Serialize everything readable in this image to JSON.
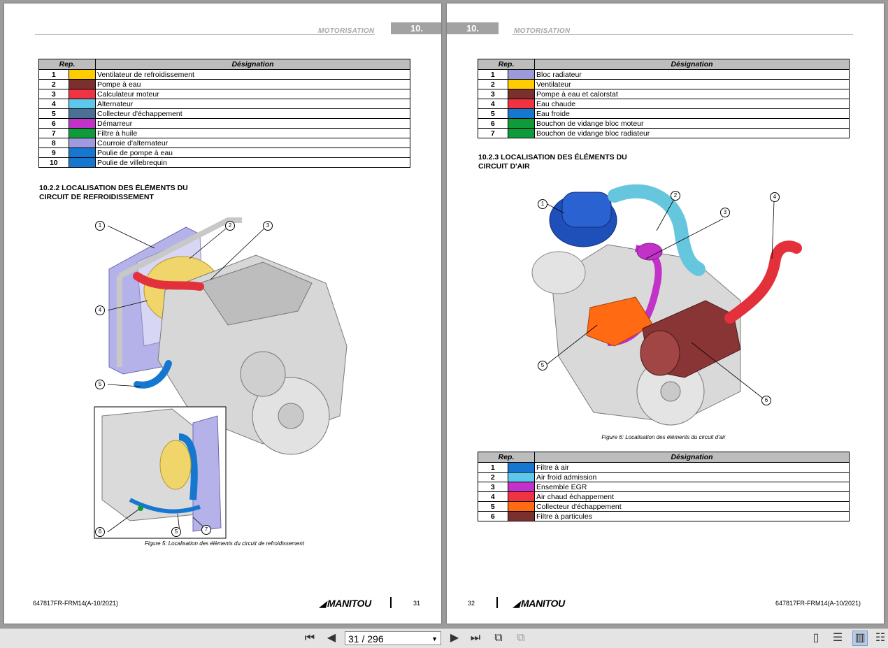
{
  "left_page": {
    "header": {
      "title": "MOTORISATION",
      "section": "10."
    },
    "table1": {
      "headers": {
        "rep": "Rep.",
        "designation": "Désignation"
      },
      "rows": [
        {
          "num": "1",
          "color": "#ffcc00",
          "label": "Ventilateur de refroidissement"
        },
        {
          "num": "2",
          "color": "#7b3030",
          "label": "Pompe à eau"
        },
        {
          "num": "3",
          "color": "#ef3340",
          "label": "Calculateur moteur"
        },
        {
          "num": "4",
          "color": "#5ec8ec",
          "label": "Alternateur"
        },
        {
          "num": "5",
          "color": "#4a7195",
          "label": "Collecteur d'échappement"
        },
        {
          "num": "6",
          "color": "#c232c8",
          "label": "Démarreur"
        },
        {
          "num": "7",
          "color": "#0f9b3a",
          "label": "Filtre à huile"
        },
        {
          "num": "8",
          "color": "#a09ade",
          "label": "Courroie d'alternateur"
        },
        {
          "num": "9",
          "color": "#1677d1",
          "label": "Poulie de pompe à eau"
        },
        {
          "num": "10",
          "color": "#1677d1",
          "label": "Poulie de villebrequin"
        }
      ]
    },
    "section_title_line1": "10.2.2 LOCALISATION DES ÉLÉMENTS DU",
    "section_title_line2": "CIRCUIT DE REFROIDISSEMENT",
    "figure_caption": "Figure 5: Localisation des éléments du circuit de refroidissement",
    "callouts": [
      "1",
      "2",
      "3",
      "4",
      "5",
      "6",
      "5",
      "7"
    ],
    "footer": {
      "code": "647817FR-FRM14(A-10/2021)",
      "brand": "MANITOU",
      "page": "31"
    }
  },
  "right_page": {
    "header": {
      "title": "MOTORISATION",
      "section": "10."
    },
    "table1": {
      "headers": {
        "rep": "Rep.",
        "designation": "Désignation"
      },
      "rows": [
        {
          "num": "1",
          "color": "#9b9bdc",
          "label": "Bloc radiateur"
        },
        {
          "num": "2",
          "color": "#ffcc00",
          "label": "Ventilateur"
        },
        {
          "num": "3",
          "color": "#7b3030",
          "label": "Pompe à eau et calorstat"
        },
        {
          "num": "4",
          "color": "#ef3340",
          "label": "Eau chaude"
        },
        {
          "num": "5",
          "color": "#1677d1",
          "label": "Eau froide"
        },
        {
          "num": "6",
          "color": "#0f9b3a",
          "label": "Bouchon de vidange bloc moteur"
        },
        {
          "num": "7",
          "color": "#0f9b3a",
          "label": "Bouchon de vidange bloc radiateur"
        }
      ]
    },
    "section_title_line1": "10.2.3 LOCALISATION DES ÉLÉMENTS DU",
    "section_title_line2": "CIRCUIT D'AIR",
    "figure_caption": "Figure 6: Localisation des éléments du circuit d'air",
    "callouts": [
      "1",
      "2",
      "3",
      "4",
      "5",
      "6"
    ],
    "table2": {
      "headers": {
        "rep": "Rep.",
        "designation": "Désignation"
      },
      "rows": [
        {
          "num": "1",
          "color": "#1677d1",
          "label": "Filtre à air"
        },
        {
          "num": "2",
          "color": "#5ec8ec",
          "label": "Air froid admission"
        },
        {
          "num": "3",
          "color": "#c232c8",
          "label": "Ensemble EGR"
        },
        {
          "num": "4",
          "color": "#ef3340",
          "label": "Air chaud échappement"
        },
        {
          "num": "5",
          "color": "#ff6a13",
          "label": "Collecteur d'échappement"
        },
        {
          "num": "6",
          "color": "#7b3030",
          "label": "Filtre à particules"
        }
      ]
    },
    "footer": {
      "code": "647817FR-FRM14(A-10/2021)",
      "brand": "MANITOU",
      "page": "32"
    }
  },
  "toolbar": {
    "page_indicator": "31 / 296",
    "icons": [
      "first-page-icon",
      "previous-page-icon",
      "next-page-icon",
      "last-page-icon",
      "rotate-icon",
      "rotate-alt-icon",
      "single-page-icon",
      "continuous-icon",
      "facing-icon",
      "facing-continuous-icon"
    ]
  }
}
